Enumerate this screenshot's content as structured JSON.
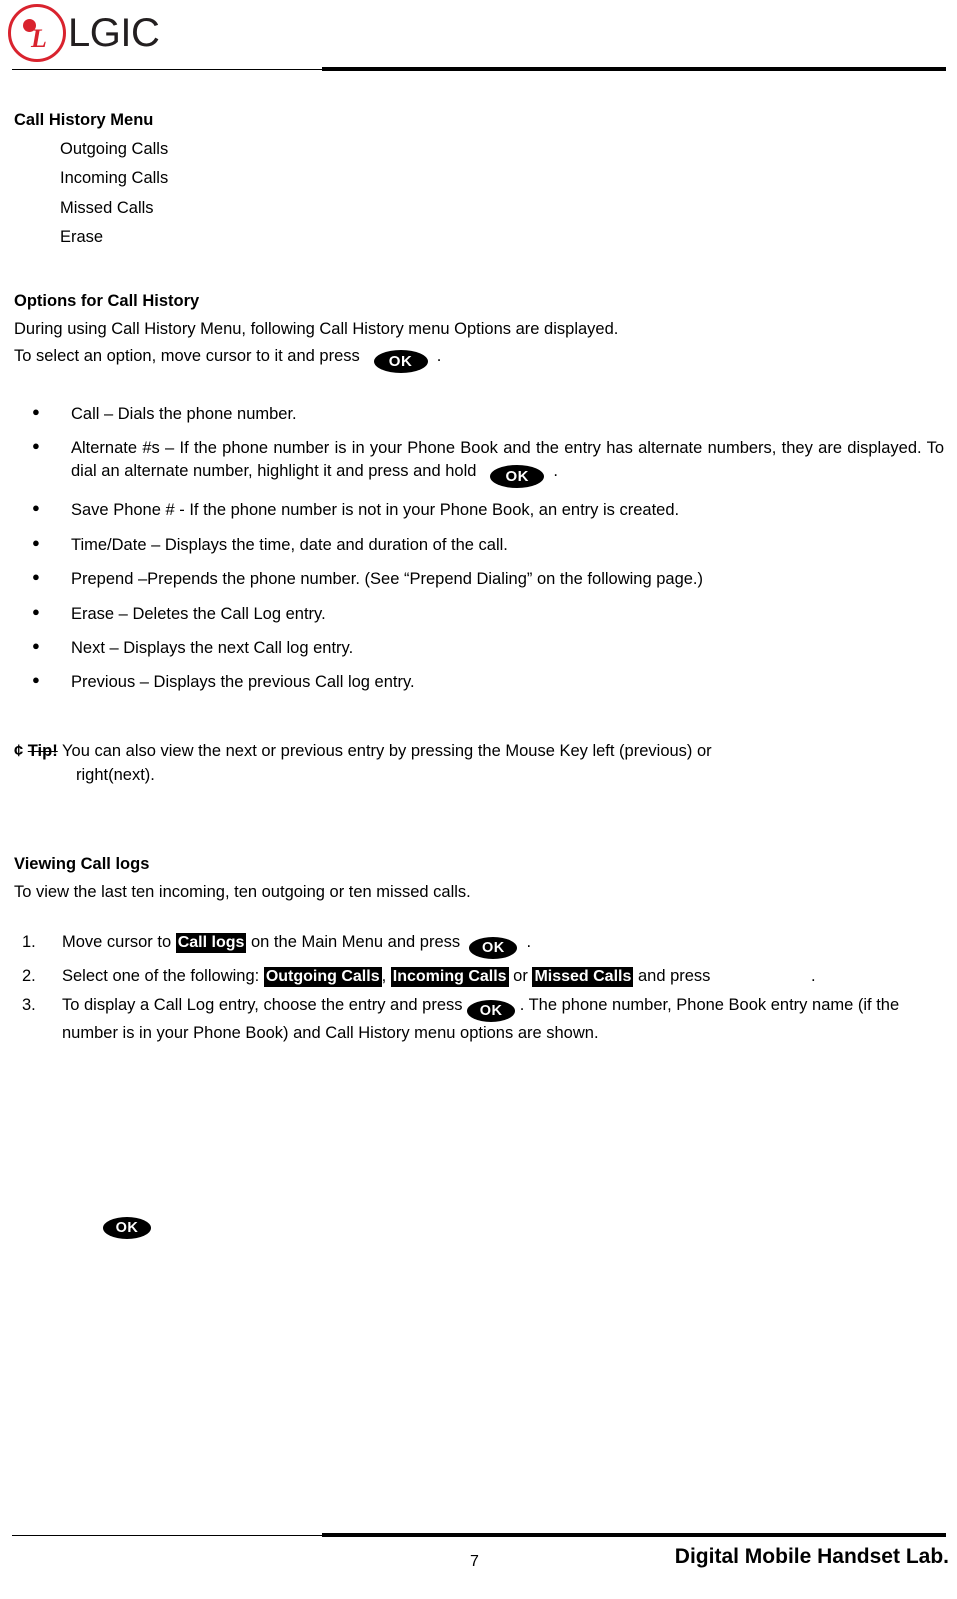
{
  "header": {
    "brand": "LGIC",
    "logo_letter": "L"
  },
  "sections": {
    "call_history_menu": {
      "title": "Call History Menu",
      "items": [
        "Outgoing Calls",
        "Incoming Calls",
        "Missed Calls",
        "Erase"
      ]
    },
    "options": {
      "title": "Options for Call History",
      "intro_line1": "During using Call History Menu, following Call History menu Options are displayed.",
      "intro_line2_before": "To select an option, move cursor to it and press",
      "intro_line2_after": ".",
      "ok_key": "OK",
      "bullets": [
        {
          "text_before": "Call – Dials the phone number.",
          "has_key": false,
          "text_after": ""
        },
        {
          "text_before": "Alternate #s – If the phone number is in your Phone Book and the entry has alternate numbers, they are displayed. To dial an alternate number, highlight it and press and hold",
          "has_key": true,
          "text_after": "."
        },
        {
          "text_before": "Save Phone # - If the phone number is not in your Phone Book, an entry is created.",
          "has_key": false,
          "text_after": ""
        },
        {
          "text_before": "Time/Date – Displays the time, date and duration of the call.",
          "has_key": false,
          "text_after": ""
        },
        {
          "text_before": "Prepend –Prepends the phone number. (See “Prepend Dialing” on the following page.)",
          "has_key": false,
          "text_after": ""
        },
        {
          "text_before": "Erase – Deletes the Call Log entry.",
          "has_key": false,
          "text_after": ""
        },
        {
          "text_before": "Next – Displays the next Call log entry.",
          "has_key": false,
          "text_after": ""
        },
        {
          "text_before": "Previous – Displays the previous Call log entry.",
          "has_key": false,
          "text_after": ""
        }
      ]
    },
    "tip": {
      "marker": "¢",
      "label": "Tip!",
      "line1": "You can also view the next or previous entry by pressing the Mouse Key left (previous) or",
      "line2": "right(next)."
    },
    "viewing": {
      "title": "Viewing Call logs",
      "intro": "To view the last ten incoming, ten outgoing or ten missed calls.",
      "steps": [
        {
          "num": "1.",
          "part1": "Move cursor to",
          "hl1": "Call logs",
          "part2": "on the Main Menu and press",
          "part3": ".",
          "key": "OK"
        },
        {
          "num": "2.",
          "part1": "Select one of the following:",
          "hl1": "Outgoing Calls",
          "sep1": ",",
          "hl2": "Incoming Calls",
          "sep2": "or",
          "hl3": "Missed Calls",
          "part2": "and press",
          "part3": "."
        },
        {
          "num": "3.",
          "part1": "To display a Call Log entry, choose the entry and press",
          "part2": ". The phone number, Phone Book entry name (if the number is in your Phone Book) and Call History menu options are shown.",
          "key": "OK"
        }
      ]
    }
  },
  "footer": {
    "page_number": "7",
    "lab": "Digital Mobile Handset Lab."
  }
}
